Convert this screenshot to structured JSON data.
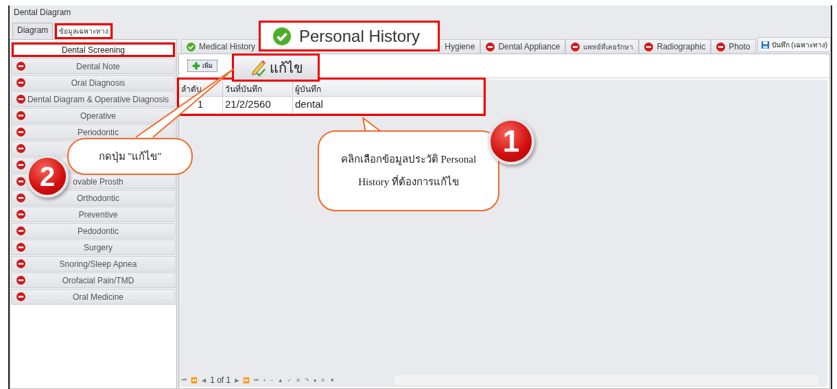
{
  "window": {
    "title": "Dental Diagram"
  },
  "outer_tabs": [
    {
      "label": "Diagram",
      "selected": false,
      "highlighted": false
    },
    {
      "label": "ข้อมูลเฉพาะทาง",
      "selected": true,
      "highlighted": true
    }
  ],
  "sections": [
    {
      "label": "Dental Screening",
      "selected": true,
      "highlighted": true
    },
    {
      "label": "Dental Note",
      "complete": false,
      "selected": false,
      "highlighted": false
    },
    {
      "label": "Oral Diagnosis",
      "complete": false,
      "selected": false,
      "highlighted": false
    },
    {
      "label": "Dental Diagram & Operative Diagnosis",
      "complete": false,
      "selected": false,
      "highlighted": false
    },
    {
      "label": "Operative",
      "complete": false,
      "selected": false,
      "highlighted": false
    },
    {
      "label": "Periodontic",
      "complete": false,
      "selected": false,
      "highlighted": false
    },
    {
      "complete": false,
      "selected": false,
      "highlighted": false
    },
    {
      "complete": false,
      "selected": false,
      "highlighted": false
    },
    {
      "label": "ovable Prosth",
      "complete": false,
      "selected": false,
      "highlighted": false
    },
    {
      "label": "Orthodontic",
      "complete": false,
      "selected": false,
      "highlighted": false
    },
    {
      "label": "Preventive",
      "complete": false,
      "selected": false,
      "highlighted": false
    },
    {
      "label": "Pedodontic",
      "complete": false,
      "selected": false,
      "highlighted": false
    },
    {
      "label": "Surgery",
      "complete": false,
      "selected": false,
      "highlighted": false
    },
    {
      "label": "Snoring/Sleep Apnea",
      "complete": false,
      "selected": false,
      "highlighted": false
    },
    {
      "label": "Orofacial Pain/TMD",
      "complete": false,
      "selected": false,
      "highlighted": false
    },
    {
      "label": "Oral Medicine",
      "complete": false,
      "selected": false,
      "highlighted": false
    }
  ],
  "section_tabs": [
    {
      "label": "Medical History",
      "complete": true
    },
    {
      "label": "Hygiene"
    },
    {
      "label": "Dental Appliance",
      "complete": false
    },
    {
      "label": "แพทย์ที่เคยรักษา",
      "complete": false
    },
    {
      "label": "Radiographic",
      "complete": false
    },
    {
      "label": "Photo",
      "complete": false
    }
  ],
  "save_button": {
    "label": "บันทึก (เฉพาะทาง)"
  },
  "toolbar": {
    "add_button": "เพิ่ม"
  },
  "grid": {
    "highlighted": true,
    "columns": [
      "ลำดับ",
      "วันที่บันทึก",
      "ผู้บันทึก"
    ],
    "rows": [
      [
        "1",
        "21/2/2560",
        "dental"
      ]
    ]
  },
  "navigator": {
    "buttons_before": [
      "⏮",
      "⏪",
      "◀"
    ],
    "position": "1 of 1",
    "buttons_after": [
      "▶",
      "⏩",
      "⏭",
      "+",
      "−",
      "▲",
      "✓",
      "✕",
      "↷",
      "●",
      "✳",
      "▼"
    ]
  },
  "zoom_insets": [
    {
      "kind": "tab",
      "label": "Personal History",
      "complete": true
    },
    {
      "kind": "button",
      "label": "แก้ไข"
    }
  ],
  "callouts": [
    {
      "number": "2",
      "text": "กดปุ่ม \"แก้ไข\""
    },
    {
      "number": "1",
      "text": "คลิกเลือกข้อมูลประวัติ Personal History ที่ต้องการแก้ไข"
    }
  ]
}
